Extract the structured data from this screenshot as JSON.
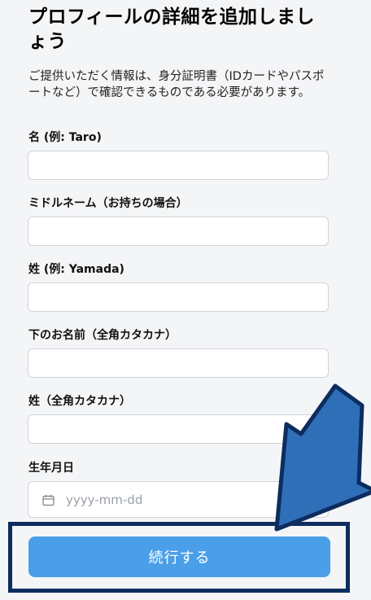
{
  "form": {
    "title": "プロフィールの詳細を追加しましょう",
    "description": "ご提供いただく情報は、身分証明書（IDカードやパスポートなど）で確認できるものである必要があります。",
    "fields": {
      "first_name": {
        "label": "名 (例: Taro)",
        "value": ""
      },
      "middle_name": {
        "label": "ミドルネーム（お持ちの場合）",
        "value": ""
      },
      "last_name": {
        "label": "姓 (例: Yamada)",
        "value": ""
      },
      "first_name_kana": {
        "label": "下のお名前（全角カタカナ）",
        "value": ""
      },
      "last_name_kana": {
        "label": "姓（全角カタカナ）",
        "value": ""
      },
      "birthdate": {
        "label": "生年月日",
        "placeholder": "yyyy-mm-dd",
        "icon": "calendar-icon"
      }
    },
    "continue_label": "続行する"
  },
  "annotation": {
    "arrow_icon": "arrow-down-left-icon",
    "arrow_color": "#2f6fb8",
    "arrow_outline_color": "#0c2d5e",
    "frame_color": "#0c2d5e"
  },
  "colors": {
    "background": "#f4f5f7",
    "button": "#4b9fe8",
    "input_border": "#cfd3d8"
  }
}
